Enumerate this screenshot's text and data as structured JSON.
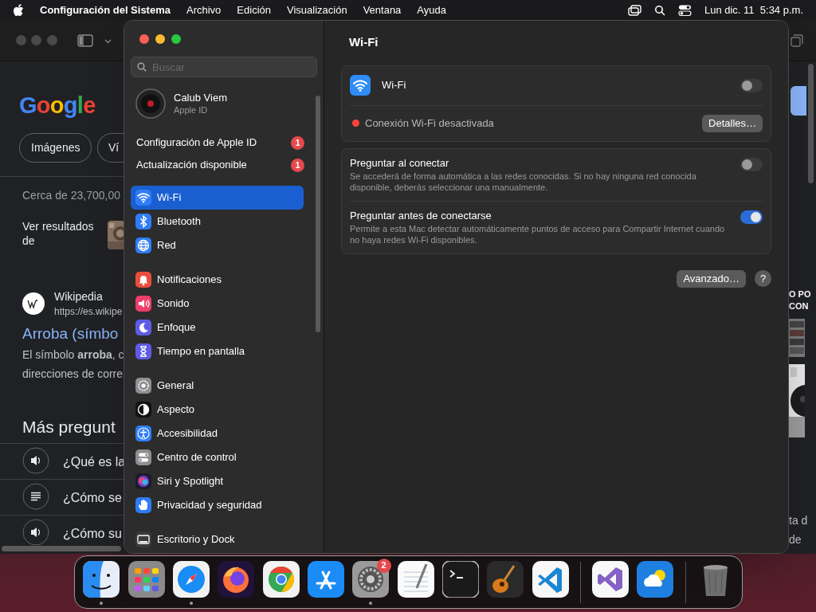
{
  "menu_bar": {
    "app": "Configuración del Sistema",
    "menus": [
      "Archivo",
      "Edición",
      "Visualización",
      "Ventana",
      "Ayuda"
    ],
    "clock": "Lun dic. 11  5:34 p.m."
  },
  "browser": {
    "logo": "Google",
    "chips": [
      "Imágenes",
      "Ví"
    ],
    "result_count": "Cerca de 23,700,00",
    "see_results": "Ver resultados de",
    "source": "Wikipedia",
    "url": "https://es.wikipe",
    "result_title": "Arroba (símbo",
    "snippet_lines": [
      "El símbolo **arroba**, c",
      "direcciones de corre"
    ],
    "questions_heading": "Más pregunt",
    "questions": [
      {
        "kind": "audio",
        "text": "¿Qué es la"
      },
      {
        "kind": "list",
        "text": "¿Cómo se"
      },
      {
        "kind": "audio",
        "text": "¿Cómo su"
      }
    ],
    "right_heading_lines": [
      "O PO",
      "CON"
    ],
    "right_text_lines": [
      "ta d",
      "de"
    ]
  },
  "settings": {
    "search": {
      "placeholder": "Buscar"
    },
    "account": {
      "name": "Calub Viem",
      "subtitle": "Apple ID"
    },
    "alerts": [
      {
        "label": "Configuración de Apple ID",
        "badge": "1"
      },
      {
        "label": "Actualización disponible",
        "badge": "1"
      }
    ],
    "sections": [
      {
        "items": [
          {
            "kind": "wifi",
            "label": "Wi-Fi",
            "selected": true
          },
          {
            "kind": "bluetooth",
            "label": "Bluetooth",
            "selected": false
          },
          {
            "kind": "network",
            "label": "Red",
            "selected": false
          }
        ]
      },
      {
        "items": [
          {
            "kind": "notifications",
            "label": "Notificaciones",
            "selected": false
          },
          {
            "kind": "sound",
            "label": "Sonido",
            "selected": false
          },
          {
            "kind": "focus",
            "label": "Enfoque",
            "selected": false
          },
          {
            "kind": "screentime",
            "label": "Tiempo en pantalla",
            "selected": false
          }
        ]
      },
      {
        "items": [
          {
            "kind": "general",
            "label": "General",
            "selected": false
          },
          {
            "kind": "appearance",
            "label": "Aspecto",
            "selected": false
          },
          {
            "kind": "accessibility",
            "label": "Accesibilidad",
            "selected": false
          },
          {
            "kind": "controlcenter",
            "label": "Centro de control",
            "selected": false
          },
          {
            "kind": "siri",
            "label": "Siri y Spotlight",
            "selected": false
          },
          {
            "kind": "privacy",
            "label": "Privacidad y seguridad",
            "selected": false
          }
        ]
      },
      {
        "items": [
          {
            "kind": "dock",
            "label": "Escritorio y Dock",
            "selected": false
          }
        ]
      }
    ]
  },
  "wifi_panel": {
    "title": "Wi-Fi",
    "wifi": {
      "label": "Wi-Fi",
      "on": false
    },
    "status": "Conexión Wi-Fi desactivada",
    "details_button": "Detalles…",
    "options": [
      {
        "title": "Preguntar al conectar",
        "description": "Se accederá de forma automática a las redes conocidas. Si no hay ninguna red conocida disponible, deberás seleccionar una manualmente.",
        "on": false
      },
      {
        "title": "Preguntar antes de conectarse",
        "description": "Permite a esta Mac detectar automáticamente puntos de acceso para Compartir Internet cuando no haya redes Wi-Fi disponibles.",
        "on": true
      }
    ],
    "advanced_button": "Avanzado…",
    "help_button": "?"
  },
  "dock": {
    "items": [
      {
        "kind": "finder",
        "running": true
      },
      {
        "kind": "launchpad",
        "running": false
      },
      {
        "kind": "safari",
        "running": true
      },
      {
        "kind": "firefox",
        "running": false
      },
      {
        "kind": "chrome",
        "running": false
      },
      {
        "kind": "appstore",
        "running": false
      },
      {
        "kind": "settings",
        "running": true,
        "badge": "2"
      },
      {
        "kind": "notes",
        "running": false
      },
      {
        "kind": "terminal",
        "running": false
      },
      {
        "kind": "guitar",
        "running": false
      },
      {
        "kind": "code",
        "running": false
      },
      {
        "kind": "separator"
      },
      {
        "kind": "studio",
        "running": false
      },
      {
        "kind": "weather",
        "running": false
      },
      {
        "kind": "separator"
      },
      {
        "kind": "trash",
        "running": false
      }
    ]
  }
}
